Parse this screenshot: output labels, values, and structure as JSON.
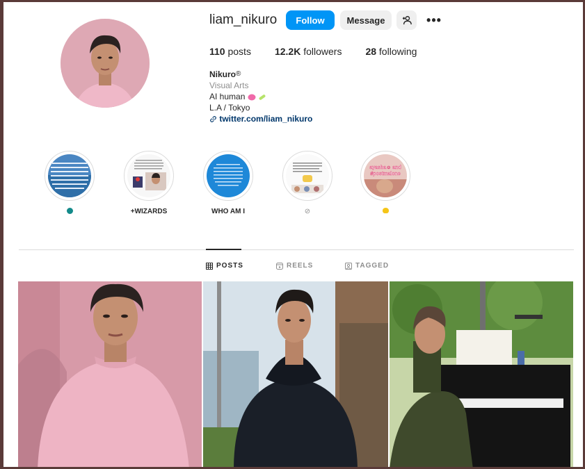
{
  "profile": {
    "username": "liam_nikuro",
    "follow_label": "Follow",
    "message_label": "Message",
    "more_glyph": "•••",
    "posts_count": "110",
    "posts_label": "posts",
    "followers_count": "12.2K",
    "followers_label": "followers",
    "following_count": "28",
    "following_label": "following",
    "display_name": "Nikuro",
    "registered_mark": "®",
    "category": "Visual Arts",
    "bio_line1": "AI human",
    "bio_line2": "L.A / Tokyo",
    "link": "twitter.com/liam_nikuro"
  },
  "highlights": [
    {
      "label": "",
      "emoji": "●"
    },
    {
      "label": "+WIZARDS",
      "emoji": ""
    },
    {
      "label": "WHO AM I",
      "emoji": ""
    },
    {
      "label": "",
      "emoji": "🔗"
    },
    {
      "label": "",
      "emoji": "💛"
    }
  ],
  "tabs": [
    {
      "label": "POSTS",
      "icon": "grid-icon",
      "active": true
    },
    {
      "label": "REELS",
      "icon": "reels-icon",
      "active": false
    },
    {
      "label": "TAGGED",
      "icon": "tagged-icon",
      "active": false
    }
  ],
  "highlight_texts": {
    "h5_line1": "ayasha☺ and",
    "h5_line2": "#postmalone"
  },
  "colors": {
    "accent": "#0095f6",
    "link": "#00376b",
    "muted": "#8e8e8e"
  }
}
